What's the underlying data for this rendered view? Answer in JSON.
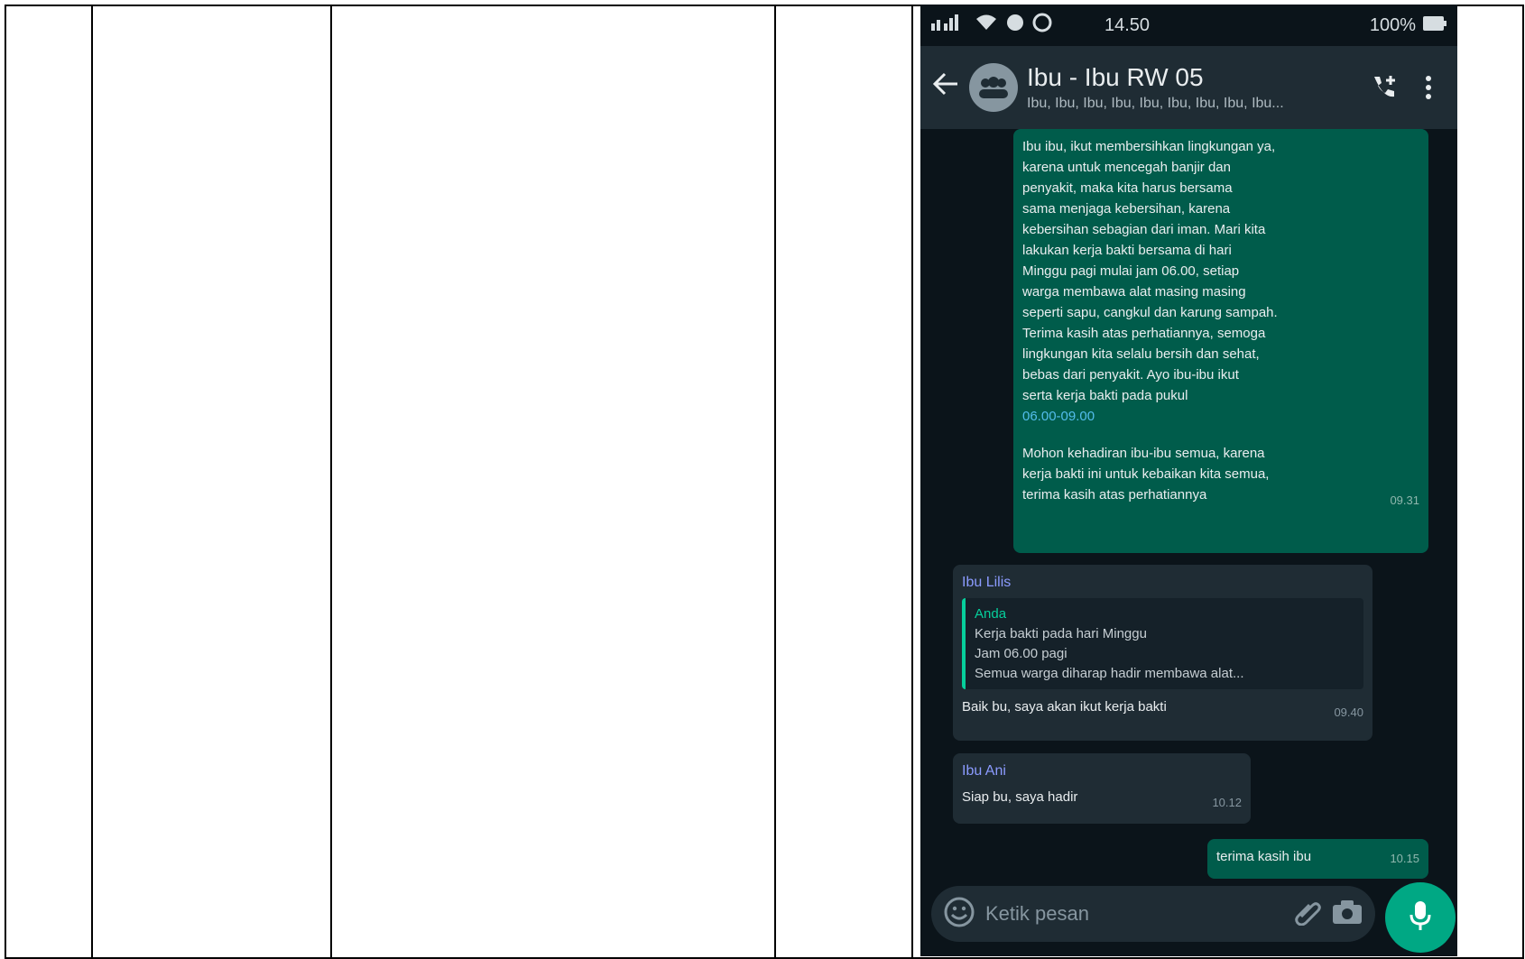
{
  "status_bar": {
    "time": "14.50",
    "battery": "100%"
  },
  "chat": {
    "title": "Ibu - Ibu RW 05",
    "subtitle": "Ibu, Ibu, Ibu, Ibu, Ibu, Ibu, Ibu, Ibu, Ibu..."
  },
  "messages": [
    {
      "type": "outgoing",
      "lines": [
        "Ibu ibu, ikut membersihkan lingkungan ya,",
        "karena untuk mencegah banjir dan",
        "penyakit, maka kita harus bersama",
        "sama menjaga kebersihan, karena",
        "kebersihan sebagian dari iman. Mari kita",
        "lakukan kerja bakti bersama di hari",
        "Minggu pagi mulai jam 06.00, setiap",
        "warga membawa alat masing masing",
        "seperti sapu, cangkul dan karung sampah.",
        "Terima kasih atas perhatiannya, semoga",
        "lingkungan kita selalu bersih dan sehat,",
        "bebas dari penyakit. Ayo ibu-ibu ikut",
        "serta kerja bakti pada pukul"
      ],
      "link": "06.00-09.00",
      "lines2": [
        "Mohon kehadiran ibu-ibu semua, karena",
        "kerja bakti ini untuk kebaikan kita semua,",
        "terima kasih atas perhatiannya"
      ],
      "time": "09.31"
    },
    {
      "type": "incoming",
      "sender": "Ibu Lilis",
      "quote_name": "Anda",
      "quote_lines": [
        "Kerja bakti pada hari Minggu",
        "Jam 06.00 pagi",
        "Semua warga diharap hadir membawa alat..."
      ],
      "text": "Baik bu, saya akan ikut kerja bakti",
      "time": "09.40"
    },
    {
      "type": "incoming",
      "sender": "Ibu Ani",
      "text": "Siap bu, saya hadir",
      "time": "10.12"
    },
    {
      "type": "outgoing",
      "text": "terima kasih ibu",
      "time": "10.15"
    }
  ],
  "input": {
    "placeholder": "Ketik pesan"
  }
}
